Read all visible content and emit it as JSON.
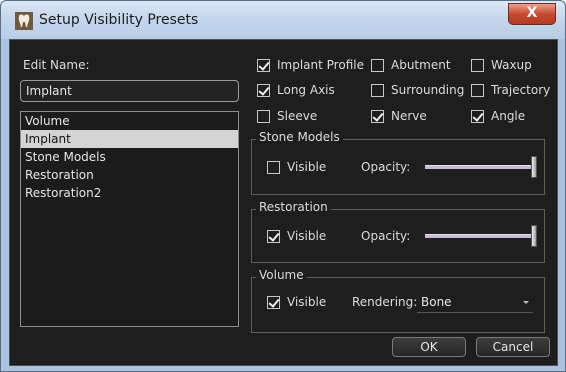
{
  "window": {
    "title": "Setup Visibility Presets",
    "close_glyph": "X"
  },
  "edit_name": {
    "label": "Edit Name:",
    "value": "Implant"
  },
  "preset_list": {
    "items": [
      "Volume",
      "Implant",
      "Stone Models",
      "Restoration",
      "Restoration2"
    ],
    "selected": "Implant"
  },
  "toggles": [
    {
      "label": "Implant Profile",
      "checked": true
    },
    {
      "label": "Abutment",
      "checked": false
    },
    {
      "label": "Waxup",
      "checked": false
    },
    {
      "label": "Long Axis",
      "checked": true
    },
    {
      "label": "Surrounding",
      "checked": false
    },
    {
      "label": "Trajectory",
      "checked": false
    },
    {
      "label": "Sleeve",
      "checked": false
    },
    {
      "label": "Nerve",
      "checked": true
    },
    {
      "label": "Angle",
      "checked": true
    }
  ],
  "stone_models": {
    "title": "Stone Models",
    "visible_label": "Visible",
    "visible": false,
    "opacity_label": "Opacity:",
    "opacity": 1.0
  },
  "restoration": {
    "title": "Restoration",
    "visible_label": "Visible",
    "visible": true,
    "opacity_label": "Opacity:",
    "opacity": 1.0
  },
  "volume": {
    "title": "Volume",
    "visible_label": "Visible",
    "visible": true,
    "rendering_label": "Rendering:",
    "rendering_value": "Bone"
  },
  "buttons": {
    "ok": "OK",
    "cancel": "Cancel"
  },
  "icons": {
    "app": "tooth-icon",
    "close": "close-icon",
    "dropdown": "chevron-down-icon"
  },
  "colors": {
    "client_bg": "#1e1e1e",
    "selection": "#d4d4d4",
    "close_red": "#c8492f",
    "slider": "#c9b9d8"
  }
}
